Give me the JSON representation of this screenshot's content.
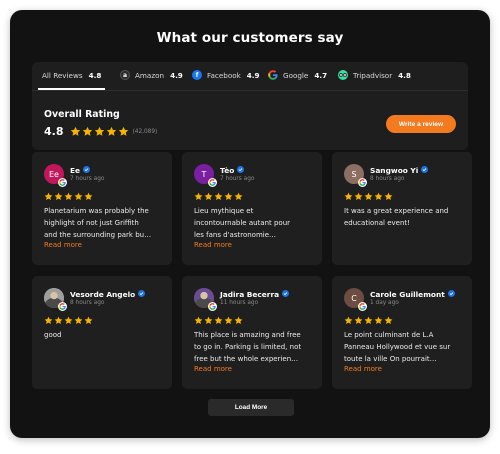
{
  "title": "What our customers say",
  "tabs": [
    {
      "label": "All Reviews",
      "rating": "4.8",
      "icon": "none"
    },
    {
      "label": "Amazon",
      "rating": "4.9",
      "icon": "amazon-icon"
    },
    {
      "label": "Facebook",
      "rating": "4.9",
      "icon": "facebook-icon"
    },
    {
      "label": "Google",
      "rating": "4.7",
      "icon": "google-icon"
    },
    {
      "label": "Tripadvisor",
      "rating": "4.8",
      "icon": "tripadvisor-icon"
    }
  ],
  "overall": {
    "label": "Overall Rating",
    "score": "4.8",
    "count": "(42,089)",
    "stars": 5
  },
  "write_button": "Write a review",
  "reviews": [
    {
      "name": "Ee",
      "initial": "Ee",
      "time": "7 hours ago",
      "stars": 5,
      "lines": [
        "Planetarium was probably the",
        "highlight of not just Griffith",
        "and the surrounding park bu…"
      ],
      "read_more": "Read more",
      "avatar_color": "#c2185b"
    },
    {
      "name": "Tèo",
      "initial": "T",
      "time": "7 hours ago",
      "stars": 5,
      "lines": [
        "Lieu mythique et",
        "incontournable autant pour",
        "les fans d'astronomie…"
      ],
      "read_more": "Read more",
      "avatar_color": "#7b1fa2"
    },
    {
      "name": "Sangwoo Yi",
      "initial": "S",
      "time": "8 hours ago",
      "stars": 5,
      "lines": [
        "It was a great experience and",
        "educational event!"
      ],
      "read_more": "",
      "avatar_color": "#8d6e63"
    },
    {
      "name": "Vesorde Angelo",
      "initial": "",
      "time": "8 hours ago",
      "stars": 5,
      "lines": [
        "good"
      ],
      "read_more": "",
      "avatar_color": "#9e9e9e"
    },
    {
      "name": "Jadira Becerra",
      "initial": "",
      "time": "11 hours ago",
      "stars": 5,
      "lines": [
        "This place is amazing and free",
        "to go in. Parking is limited, not",
        "free but the whole experien…"
      ],
      "read_more": "Read more",
      "avatar_color": "#6a4c93"
    },
    {
      "name": "Carole Guillemont",
      "initial": "C",
      "time": "1 day ago",
      "stars": 5,
      "lines": [
        "Le point culminant de L.A",
        "Panneau Hollywood et vue sur",
        "toute la ville On pourrait…"
      ],
      "read_more": "Read more",
      "avatar_color": "#6d4c41"
    }
  ],
  "load_more": "Load More",
  "colors": {
    "accent": "#f47a1f",
    "star": "#f5b400",
    "verified": "#1a73e8"
  }
}
